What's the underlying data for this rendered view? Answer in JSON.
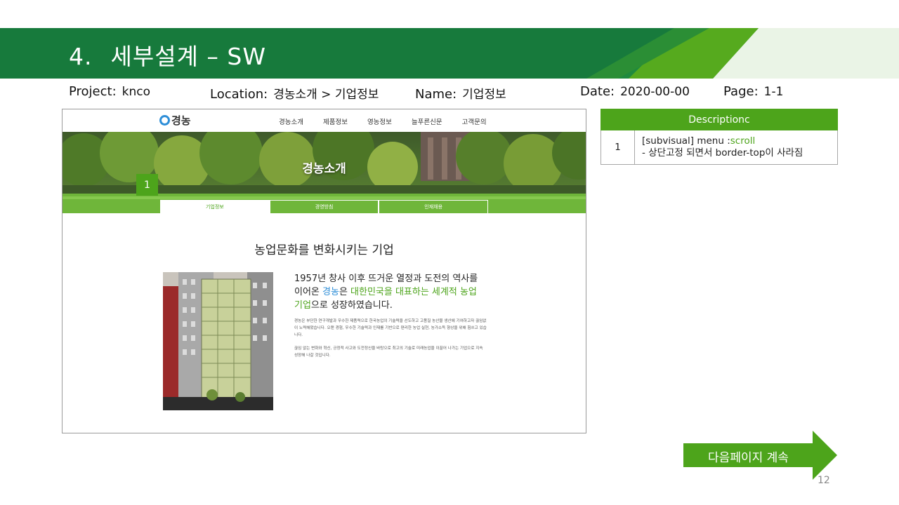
{
  "slide": {
    "number": "4.",
    "title": "세부설계 – SW",
    "page_number": "12"
  },
  "meta": {
    "project_label": "Project:",
    "project_value": "knco",
    "location_label": "Location:",
    "location_value": "경농소개 > 기업정보",
    "name_label": "Name:",
    "name_value": "기업정보",
    "date_label": "Date:",
    "date_value": "2020-00-00",
    "page_label": "Page:",
    "page_value": "1-1"
  },
  "mockup": {
    "logo_text": "경농",
    "nav": [
      "경농소개",
      "제품정보",
      "영농정보",
      "늘푸른신문",
      "고객문의"
    ],
    "visual_title": "경농소개",
    "marker": "1",
    "subtabs": [
      "기업정보",
      "경영방침",
      "인재채용"
    ],
    "heading": "농업문화를 변화시키는 기업",
    "lead_1": "1957년 창사 이후 뜨거운 열정과 도전의 역사를",
    "lead_2a": "이어온 ",
    "lead_2b": "경농",
    "lead_2c": "은 ",
    "lead_2d": "대한민국을 대표하는 세계적 농업",
    "lead_3a": "기업",
    "lead_3b": "으로 성장하였습니다.",
    "para_1": "경농은 부단한 연구개발과 우수한 제품력으로 한국농업의 기술력을 선도하고 고품질 농산물 생산에 기여하고자 끊임없이 노력해왔습니다. 오랜 경험, 우수한 기술력과 인재를 기반으로 편리한 농업 실현, 농가소득 향상을 위해 힘쓰고 있습니다.",
    "para_2": "끊임 없는 변화와 혁신, 긍정적 사고와 도전정신을 바탕으로 최고의 기술로 미래농업을 이끌어 나가는 기업으로 지속 성장해 나갈 것입니다."
  },
  "description": {
    "header": "Descriptionc",
    "rows": [
      {
        "no": "1",
        "line1_a": "[subvisual] menu :",
        "line1_b": "scroll",
        "line2": "- 상단고정 되면서  border-top이 사라짐"
      }
    ]
  },
  "next_button": "다음페이지 계속",
  "colors": {
    "brand_dark": "#177a3c",
    "brand_green": "#4da41b",
    "link_blue": "#2f8fd8"
  }
}
